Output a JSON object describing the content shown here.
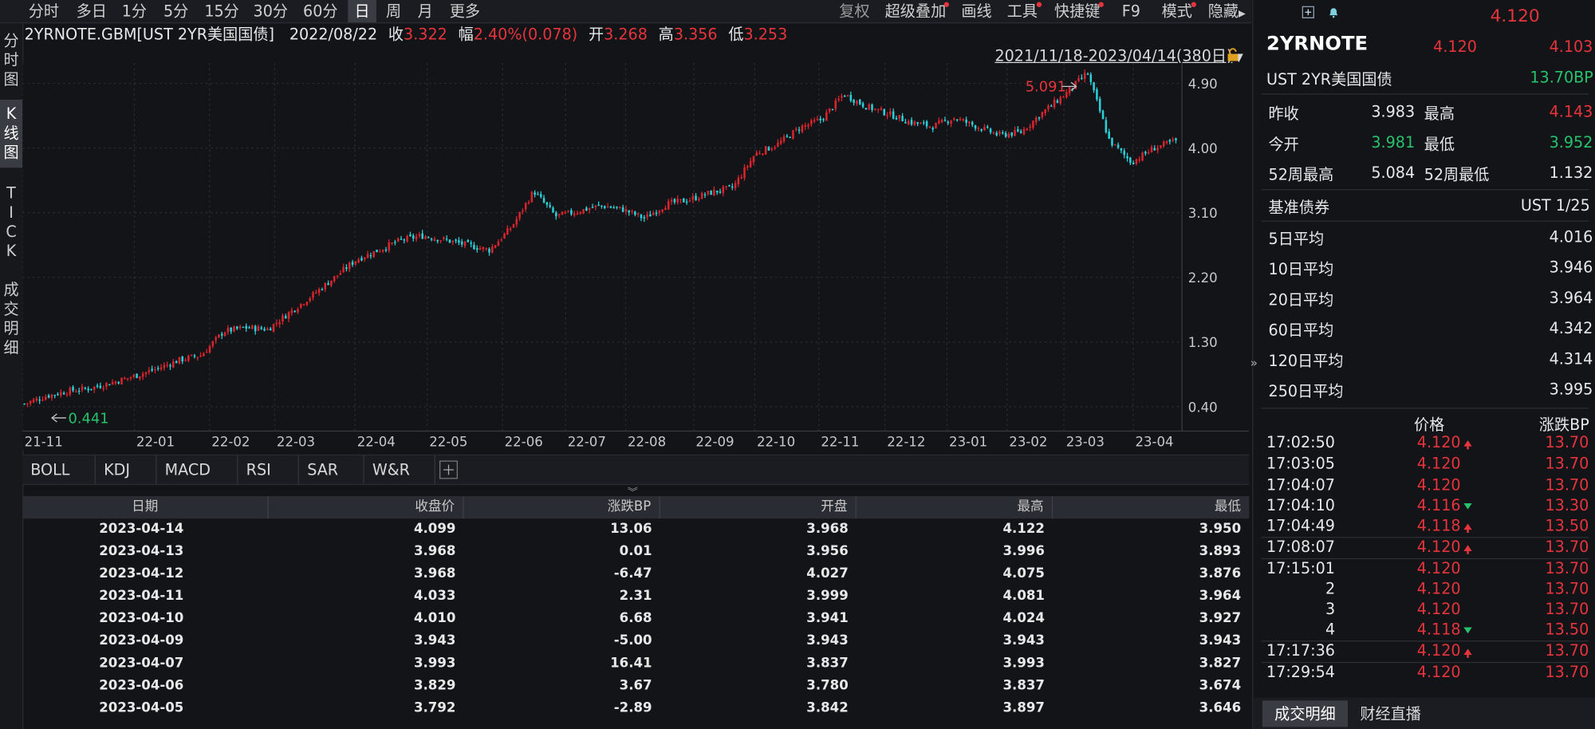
{
  "toolbar": {
    "periods": [
      "分时",
      "多日",
      "1分",
      "5分",
      "15分",
      "30分",
      "60分",
      "日",
      "周",
      "月",
      "更多"
    ],
    "active_period": "日",
    "right_items": [
      "复权",
      "超级叠加",
      "画线",
      "工具",
      "快捷键",
      "F9",
      "模式",
      "隐藏"
    ]
  },
  "left_tabs": [
    "分时图",
    "K线图",
    "TICK",
    "成交明细"
  ],
  "info": {
    "symbol": "2YRNOTE.GBM[UST 2YR美国国债]",
    "date": "2022/08/22",
    "close_label": "收",
    "close": "3.322",
    "change_label": "幅",
    "change": "2.40%(0.078)",
    "open_label": "开",
    "open": "3.268",
    "high_label": "高",
    "high": "3.356",
    "low_label": "低",
    "low": "3.253"
  },
  "range_label": "2021/11/18-2023/04/14(380日)",
  "chart_data": {
    "type": "candlestick",
    "y_ticks": [
      "4.90",
      "4.00",
      "3.10",
      "2.20",
      "1.30",
      "0.40"
    ],
    "x_ticks": [
      "21-11",
      "22-01",
      "22-02",
      "22-03",
      "22-04",
      "22-05",
      "22-06",
      "22-07",
      "22-08",
      "22-09",
      "22-10",
      "22-11",
      "22-12",
      "23-01",
      "23-02",
      "23-03",
      "23-04"
    ],
    "ylim": [
      0.4,
      4.9
    ],
    "max_label": "5.091",
    "min_label": "0.441",
    "close_series": [
      0.44,
      0.55,
      0.62,
      0.66,
      0.74,
      0.83,
      0.93,
      1.05,
      1.12,
      1.45,
      1.5,
      1.48,
      1.72,
      1.95,
      2.2,
      2.45,
      2.58,
      2.72,
      2.78,
      2.72,
      2.65,
      2.58,
      2.9,
      3.4,
      3.05,
      3.12,
      3.2,
      3.15,
      3.02,
      3.22,
      3.28,
      3.38,
      3.45,
      3.92,
      4.05,
      4.28,
      4.4,
      4.75,
      4.58,
      4.48,
      4.36,
      4.3,
      4.42,
      4.3,
      4.18,
      4.22,
      4.5,
      4.75,
      5.05,
      4.1,
      3.8,
      4.0,
      4.1
    ]
  },
  "indicator_tabs": [
    "BOLL",
    "KDJ",
    "MACD",
    "RSI",
    "SAR",
    "W&R"
  ],
  "table": {
    "headers": [
      "日期",
      "收盘价",
      "涨跌BP",
      "开盘",
      "最高",
      "最低"
    ],
    "rows": [
      [
        "2023-04-14",
        "4.099",
        "13.06",
        "3.968",
        "4.122",
        "3.950"
      ],
      [
        "2023-04-13",
        "3.968",
        "0.01",
        "3.956",
        "3.996",
        "3.893"
      ],
      [
        "2023-04-12",
        "3.968",
        "-6.47",
        "4.027",
        "4.075",
        "3.876"
      ],
      [
        "2023-04-11",
        "4.033",
        "2.31",
        "3.999",
        "4.081",
        "3.964"
      ],
      [
        "2023-04-10",
        "4.010",
        "6.68",
        "3.941",
        "4.024",
        "3.927"
      ],
      [
        "2023-04-09",
        "3.943",
        "-5.00",
        "3.943",
        "3.943",
        "3.943"
      ],
      [
        "2023-04-07",
        "3.993",
        "16.41",
        "3.837",
        "3.993",
        "3.827"
      ],
      [
        "2023-04-06",
        "3.829",
        "3.67",
        "3.780",
        "3.837",
        "3.674"
      ],
      [
        "2023-04-05",
        "3.792",
        "-2.89",
        "3.842",
        "3.897",
        "3.646"
      ]
    ]
  },
  "quote": {
    "top_price": "4.120",
    "name": "2YRNOTE",
    "bid": "4.120",
    "ask": "4.103",
    "fullname": "UST 2YR美国国债",
    "change_bp": "13.70BP",
    "prev_close_label": "昨收",
    "prev_close": "3.983",
    "high_label": "最高",
    "high": "4.143",
    "open_label": "今开",
    "open": "3.981",
    "low_label": "最低",
    "low": "3.952",
    "wk52_high_label": "52周最高",
    "wk52_high": "5.084",
    "wk52_low_label": "52周最低",
    "wk52_low": "1.132",
    "bench_label": "基准债券",
    "bench": "UST 1/25",
    "ma": [
      {
        "label": "5日平均",
        "value": "4.016"
      },
      {
        "label": "10日平均",
        "value": "3.946"
      },
      {
        "label": "20日平均",
        "value": "3.964"
      },
      {
        "label": "60日平均",
        "value": "4.342"
      },
      {
        "label": "120日平均",
        "value": "4.314"
      },
      {
        "label": "250日平均",
        "value": "3.995"
      }
    ]
  },
  "ticks": {
    "header_price": "价格",
    "header_change": "涨跌BP",
    "rows": [
      {
        "time": "17:02:50",
        "price": "4.120",
        "dir": "up",
        "change": "13.70"
      },
      {
        "time": "17:03:05",
        "price": "4.120",
        "dir": "",
        "change": "13.70"
      },
      {
        "time": "17:04:07",
        "price": "4.120",
        "dir": "",
        "change": "13.70"
      },
      {
        "time": "17:04:10",
        "price": "4.116",
        "dir": "down",
        "change": "13.30"
      },
      {
        "time": "17:04:49",
        "price": "4.118",
        "dir": "up",
        "change": "13.50"
      },
      {
        "time": "17:08:07",
        "price": "4.120",
        "dir": "up",
        "change": "13.70"
      },
      {
        "time": "17:15:01",
        "price": "4.120",
        "dir": "",
        "change": "13.70"
      },
      {
        "time": "2",
        "price": "4.120",
        "dir": "",
        "change": "13.70"
      },
      {
        "time": "3",
        "price": "4.120",
        "dir": "",
        "change": "13.70"
      },
      {
        "time": "4",
        "price": "4.118",
        "dir": "down",
        "change": "13.50"
      },
      {
        "time": "17:17:36",
        "price": "4.120",
        "dir": "up",
        "change": "13.70"
      },
      {
        "time": "17:29:54",
        "price": "4.120",
        "dir": "",
        "change": "13.70"
      }
    ]
  },
  "bottom_tabs": [
    "成交明细",
    "财经直播"
  ],
  "colors": {
    "up": "#e5343c",
    "down": "#27c26b",
    "candle_up": "#d8242c",
    "candle_down": "#2ad0d8"
  }
}
